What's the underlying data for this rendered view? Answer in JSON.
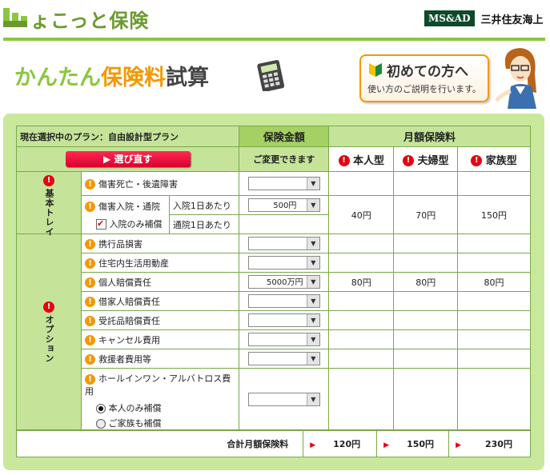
{
  "header": {
    "logo_text": "ょこっと保険",
    "brand_box": "MS&AD",
    "brand_name": "三井住友海上"
  },
  "banner": {
    "title_part1": "かんたん",
    "title_part2": "保険料",
    "title_part3": "試算"
  },
  "guide": {
    "title": "初めての方へ",
    "subtitle": "使い方のご説明を行います。"
  },
  "table": {
    "current_plan": "現在選択中のプラン：自由設計型プラン",
    "reselect_label": "選び直す",
    "coverage_header": "保険金額",
    "coverage_sub": "ご変更できます",
    "monthly_header": "月額保険料",
    "types": [
      "本人型",
      "夫婦型",
      "家族型"
    ],
    "group_basic": "基本トレイ",
    "group_option": "オプション",
    "rows": [
      {
        "label": "傷害死亡・後遺障害",
        "select": "",
        "prices": [
          "",
          "",
          ""
        ]
      },
      {
        "label": "傷害入院・通院",
        "sub_label": "入院のみ補償",
        "sub1": "入院1日あたり",
        "sub2": "通院1日あたり",
        "select": "500円",
        "prices": [
          "40円",
          "70円",
          "150円"
        ]
      },
      {
        "label": "携行品損害",
        "select": "",
        "prices": [
          "",
          "",
          ""
        ]
      },
      {
        "label": "住宅内生活用動産",
        "select": "",
        "prices": [
          "",
          "",
          ""
        ]
      },
      {
        "label": "個人賠償責任",
        "select": "5000万円",
        "prices": [
          "80円",
          "80円",
          "80円"
        ]
      },
      {
        "label": "借家人賠償責任",
        "select": "",
        "prices": [
          "",
          "",
          ""
        ]
      },
      {
        "label": "受託品賠償責任",
        "select": "",
        "prices": [
          "",
          "",
          ""
        ]
      },
      {
        "label": "キャンセル費用",
        "select": "",
        "prices": [
          "",
          "",
          ""
        ]
      },
      {
        "label": "救援者費用等",
        "select": "",
        "prices": [
          "",
          "",
          ""
        ]
      },
      {
        "label": "ホールインワン・アルバトロス費用",
        "radio1": "本人のみ補償",
        "radio2": "ご家族も補償",
        "select": "",
        "prices": [
          "",
          "",
          ""
        ]
      }
    ],
    "total_label": "合計月額保険料",
    "totals": [
      "120円",
      "150円",
      "230円"
    ]
  }
}
